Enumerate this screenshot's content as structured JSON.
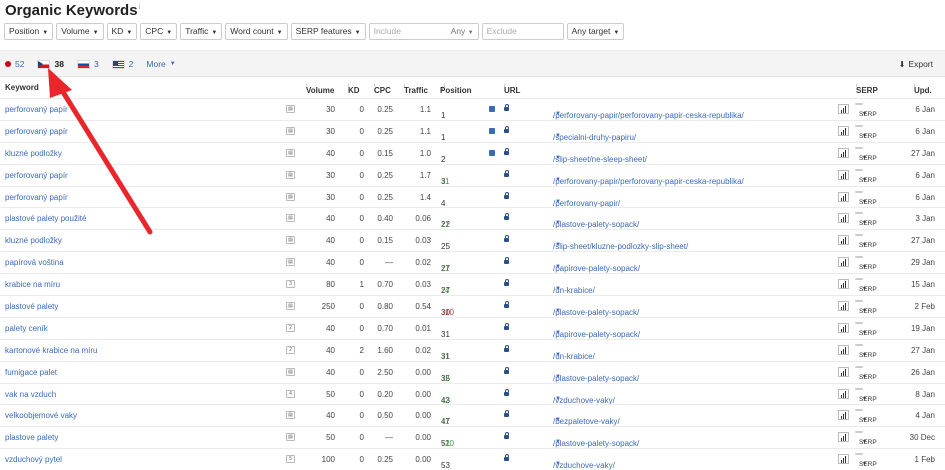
{
  "title": "Organic Keywords",
  "title_info": "i",
  "filters": {
    "buttons": [
      "Position",
      "Volume",
      "KD",
      "CPC",
      "Traffic",
      "Word count",
      "SERP features"
    ],
    "include_placeholder": "Include",
    "include_scope": "Any",
    "exclude_placeholder": "Exclude",
    "target_label": "Any target"
  },
  "country_tabs": [
    {
      "flag": "red-dot",
      "count": "52"
    },
    {
      "flag": "cz",
      "count": "38"
    },
    {
      "flag": "sk",
      "count": "3"
    },
    {
      "flag": "us",
      "count": "2"
    }
  ],
  "more_label": "More",
  "export_label": "Export",
  "columns": {
    "keyword": "Keyword",
    "volume": "Volume",
    "kd": "KD",
    "cpc": "CPC",
    "traffic": "Traffic",
    "position": "Position",
    "url": "URL",
    "serp": "SERP",
    "upd": "Upd."
  },
  "serp_button_label": "SERP",
  "rows": [
    {
      "keyword": "perforovaný papír",
      "kw_icon": "",
      "volume": "30",
      "kd": "0",
      "cpc": "0.25",
      "traffic": "1.1",
      "position": "1",
      "change": "",
      "dir": "",
      "serp_icon": true,
      "url": "/perforovany-papir/perforovany-papir-ceska-republika/",
      "upd": "6 Jan"
    },
    {
      "keyword": "perforovaný papír",
      "kw_icon": "",
      "volume": "30",
      "kd": "0",
      "cpc": "0.25",
      "traffic": "1.1",
      "position": "1",
      "change": "",
      "dir": "",
      "serp_icon": true,
      "url": "/specialni-druhy-papiru/",
      "upd": "6 Jan"
    },
    {
      "keyword": "kluzné podložky",
      "kw_icon": "",
      "volume": "40",
      "kd": "0",
      "cpc": "0.15",
      "traffic": "1.0",
      "position": "2",
      "change": "",
      "dir": "",
      "serp_icon": true,
      "url": "/slip-sheet/ne-sleep-sheet/",
      "upd": "27 Jan"
    },
    {
      "keyword": "perforovaný papír",
      "kw_icon": "",
      "volume": "30",
      "kd": "0",
      "cpc": "0.25",
      "traffic": "1.7",
      "position": "3",
      "change": "↑1",
      "dir": "up",
      "serp_icon": false,
      "url": "/perforovany-papir/perforovany-papir-ceska-republika/",
      "upd": "6 Jan"
    },
    {
      "keyword": "perforovaný papír",
      "kw_icon": "",
      "volume": "30",
      "kd": "0",
      "cpc": "0.25",
      "traffic": "1.4",
      "position": "4",
      "change": "",
      "dir": "",
      "serp_icon": false,
      "url": "/perforovany-papir/",
      "upd": "6 Jan"
    },
    {
      "keyword": "plastové palety použité",
      "kw_icon": "",
      "volume": "40",
      "kd": "0",
      "cpc": "0.40",
      "traffic": "0.06",
      "position": "22",
      "change": "↑1",
      "dir": "up",
      "serp_icon": false,
      "url": "/plastove-palety-sopack/",
      "upd": "3 Jan"
    },
    {
      "keyword": "kluzné podložky",
      "kw_icon": "",
      "volume": "40",
      "kd": "0",
      "cpc": "0.15",
      "traffic": "0.03",
      "position": "25",
      "change": "",
      "dir": "",
      "serp_icon": false,
      "url": "/slip-sheet/kluzne-podlozky-slip-sheet/",
      "upd": "27 Jan"
    },
    {
      "keyword": "papírová voština",
      "kw_icon": "",
      "volume": "40",
      "kd": "0",
      "cpc": "—",
      "traffic": "0.02",
      "position": "27",
      "change": "↑1",
      "dir": "up",
      "serp_icon": false,
      "url": "/papirove-palety-sopack/",
      "upd": "29 Jan"
    },
    {
      "keyword": "krabice na míru",
      "kw_icon": "3",
      "volume": "80",
      "kd": "1",
      "cpc": "0.70",
      "traffic": "0.03",
      "position": "27",
      "change": "↑4",
      "dir": "up",
      "serp_icon": false,
      "url": "/un-krabice/",
      "upd": "15 Jan"
    },
    {
      "keyword": "plastové palety",
      "kw_icon": "",
      "volume": "250",
      "kd": "0",
      "cpc": "0.80",
      "traffic": "0.54",
      "position": "30",
      "change": "↓10",
      "dir": "down",
      "serp_icon": false,
      "url": "/plastove-palety-sopack/",
      "upd": "2 Feb"
    },
    {
      "keyword": "palety ceník",
      "kw_icon": "2",
      "volume": "40",
      "kd": "0",
      "cpc": "0.70",
      "traffic": "0.01",
      "position": "31",
      "change": "",
      "dir": "",
      "serp_icon": false,
      "url": "/papirove-palety-sopack/",
      "upd": "19 Jan"
    },
    {
      "keyword": "kartonové krabice na míru",
      "kw_icon": "2",
      "volume": "40",
      "kd": "2",
      "cpc": "1.60",
      "traffic": "0.02",
      "position": "31",
      "change": "↑1",
      "dir": "up",
      "serp_icon": false,
      "url": "/un-krabice/",
      "upd": "27 Jan"
    },
    {
      "keyword": "fumigace palet",
      "kw_icon": "",
      "volume": "40",
      "kd": "0",
      "cpc": "2.50",
      "traffic": "0.00",
      "position": "35",
      "change": "↑2",
      "dir": "up",
      "serp_icon": false,
      "url": "/plastove-palety-sopack/",
      "upd": "26 Jan"
    },
    {
      "keyword": "vak na vzduch",
      "kw_icon": "4",
      "volume": "50",
      "kd": "0",
      "cpc": "0.20",
      "traffic": "0.00",
      "position": "43",
      "change": "↑2",
      "dir": "up",
      "serp_icon": false,
      "url": "/vzduchove-vaky/",
      "upd": "8 Jan"
    },
    {
      "keyword": "velkoobjemové vaky",
      "kw_icon": "",
      "volume": "40",
      "kd": "0",
      "cpc": "0.50",
      "traffic": "0.00",
      "position": "47",
      "change": "↑1",
      "dir": "up",
      "serp_icon": false,
      "url": "/bezpaletove-vaky/",
      "upd": "4 Jan"
    },
    {
      "keyword": "plastove palety",
      "kw_icon": "",
      "volume": "50",
      "kd": "0",
      "cpc": "—",
      "traffic": "0.00",
      "position": "51",
      "change": "↑20",
      "dir": "up",
      "serp_icon": false,
      "url": "/plastove-palety-sopack/",
      "upd": "30 Dec"
    },
    {
      "keyword": "vzduchový pytel",
      "kw_icon": "5",
      "volume": "100",
      "kd": "0",
      "cpc": "0.25",
      "traffic": "0.00",
      "position": "53",
      "change": "",
      "dir": "",
      "serp_icon": false,
      "url": "/vzduchove-vaky/",
      "upd": "1 Feb"
    }
  ]
}
